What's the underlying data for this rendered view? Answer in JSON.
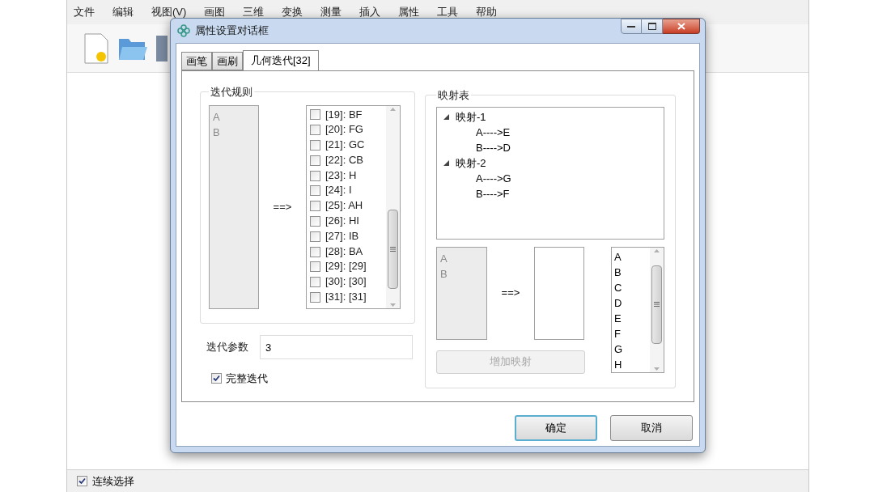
{
  "app": {
    "menu": [
      "文件",
      "编辑",
      "视图(V)",
      "画图",
      "三维",
      "变换",
      "测量",
      "插入",
      "属性",
      "工具",
      "帮助"
    ],
    "status_option": {
      "label": "连续选择",
      "checked": true
    }
  },
  "dialog": {
    "title": "属性设置对话框",
    "tabs": [
      {
        "label": "画笔",
        "selected": false
      },
      {
        "label": "画刷",
        "selected": false
      },
      {
        "label": "几何迭代[32]",
        "selected": true
      }
    ],
    "rules": {
      "title": "迭代规则",
      "source": [
        "A",
        "B"
      ],
      "arrow": "==>",
      "targets": [
        {
          "label": "[19]: BF",
          "checked": false
        },
        {
          "label": "[20]: FG",
          "checked": false
        },
        {
          "label": "[21]: GC",
          "checked": false
        },
        {
          "label": "[22]: CB",
          "checked": false
        },
        {
          "label": "[23]: H",
          "checked": false
        },
        {
          "label": "[24]: I",
          "checked": false
        },
        {
          "label": "[25]: AH",
          "checked": false
        },
        {
          "label": "[26]: HI",
          "checked": false
        },
        {
          "label": "[27]: IB",
          "checked": false
        },
        {
          "label": "[28]: BA",
          "checked": false
        },
        {
          "label": "[29]: [29]",
          "checked": false
        },
        {
          "label": "[30]: [30]",
          "checked": false
        },
        {
          "label": "[31]: [31]",
          "checked": false
        }
      ]
    },
    "param": {
      "label": "迭代参数",
      "value": "3"
    },
    "full": {
      "label": "完整迭代",
      "checked": true
    },
    "mapping": {
      "title": "映射表",
      "tree": [
        {
          "label": "映射-1",
          "expanded": true,
          "children": [
            {
              "label": "A---->E"
            },
            {
              "label": "B---->D"
            }
          ]
        },
        {
          "label": "映射-2",
          "expanded": true,
          "children": [
            {
              "label": "A---->G"
            },
            {
              "label": "B---->F"
            }
          ]
        }
      ],
      "source": [
        "A",
        "B"
      ],
      "arrow": "==>",
      "letters": [
        "A",
        "B",
        "C",
        "D",
        "E",
        "F",
        "G",
        "H"
      ],
      "add_button": {
        "label": "增加映射",
        "disabled": true
      }
    },
    "buttons": [
      {
        "label": "确定",
        "default": true
      },
      {
        "label": "取消",
        "default": false
      }
    ]
  }
}
